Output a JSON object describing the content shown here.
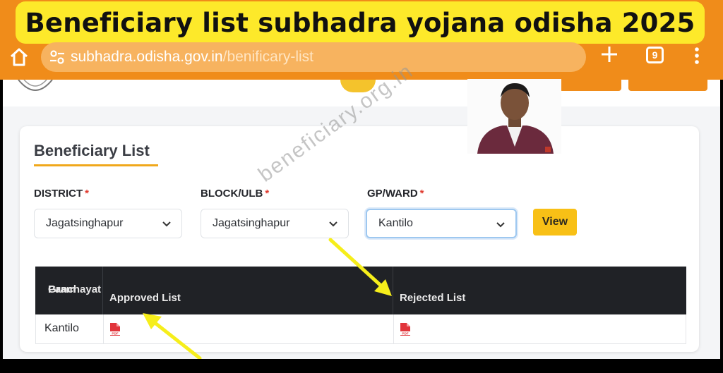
{
  "banner": {
    "title": "Beneficiary list subhadra yojana odisha 2025"
  },
  "browser": {
    "url_host": "subhadra.odisha.gov.in",
    "url_path": "/benificary-list",
    "tab_count": "9",
    "icons": [
      "home-icon",
      "site-settings-icon",
      "new-tab-icon",
      "tabs-icon",
      "more-menu-icon"
    ]
  },
  "page": {
    "card_title": "Beneficiary List",
    "fields": [
      {
        "label": "DISTRICT",
        "required": "*",
        "value": "Jagatsinghapur"
      },
      {
        "label": "BLOCK/ULB",
        "required": "*",
        "value": "Jagatsinghapur"
      },
      {
        "label": "GP/WARD",
        "required": "*",
        "value": "Kantilo"
      }
    ],
    "view_button": "View"
  },
  "table": {
    "headers": [
      "Gram Panchayat",
      "Approved List",
      "Rejected List"
    ],
    "header_lines": [
      "Gram",
      "Panchayat"
    ],
    "rows": [
      {
        "gram_panchayat": "Kantilo",
        "approved": "pdf-icon",
        "rejected": "pdf-icon"
      }
    ]
  },
  "overlay": {
    "watermark": "beneficiary.org.in"
  },
  "colors": {
    "banner_bg": "#fde92a",
    "browser_bar": "#f08c1a",
    "accent_yellow": "#f8c016",
    "required_red": "#e03b2f",
    "table_header": "#202226",
    "pdf_red": "#e1353b",
    "arrow_yellow": "#f6ee1b"
  }
}
